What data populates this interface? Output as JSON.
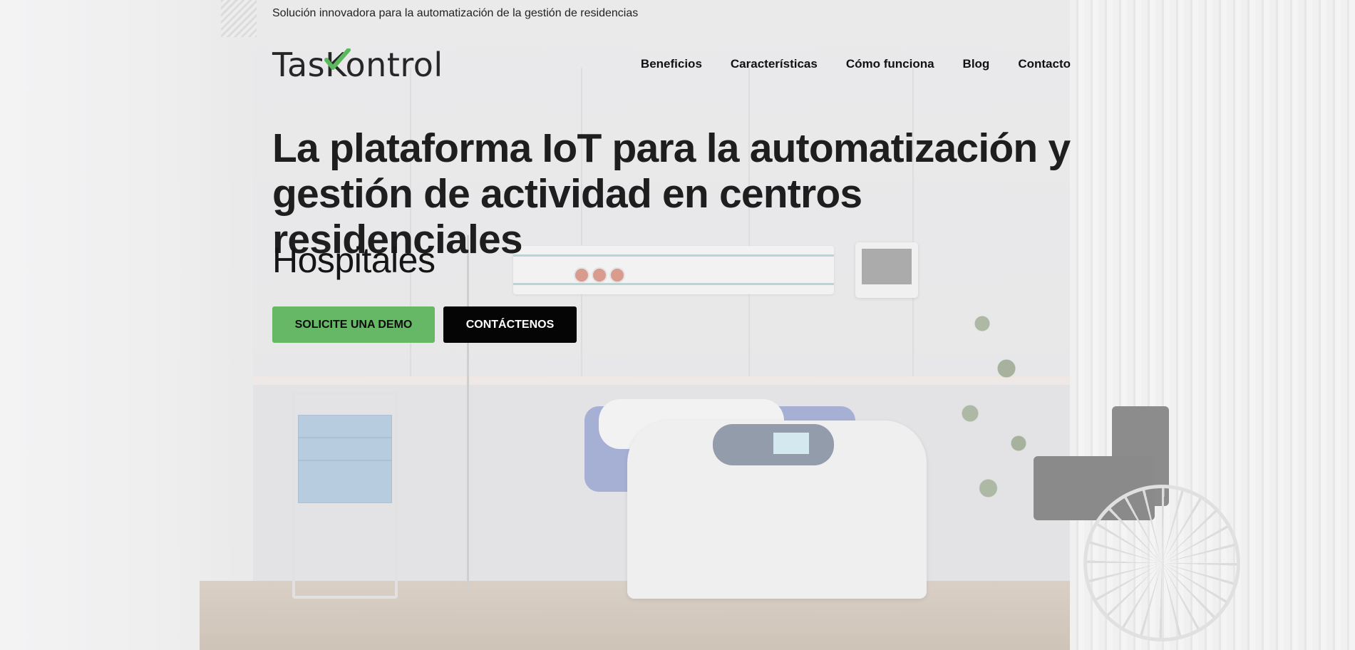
{
  "topbar": {
    "tagline": "Solución innovadora para la automatización de la gestión de residencias"
  },
  "logo": {
    "part1": "Tas",
    "part2": "Kontrol",
    "check_color": "#5cb85c"
  },
  "nav": {
    "items": [
      {
        "label": "Beneficios"
      },
      {
        "label": "Características"
      },
      {
        "label": "Cómo funciona"
      },
      {
        "label": "Blog"
      },
      {
        "label": "Contacto"
      }
    ]
  },
  "hero": {
    "title_line1": "La plataforma IoT para la automatización y",
    "title_line2": "gestión de actividad en centros residenciales",
    "subtitle": "Hospitales"
  },
  "buttons": {
    "demo_label": "SOLICITE UNA DEMO",
    "contact_label": "CONTÁCTENOS",
    "demo_color": "#66b866",
    "contact_color": "#050505"
  }
}
